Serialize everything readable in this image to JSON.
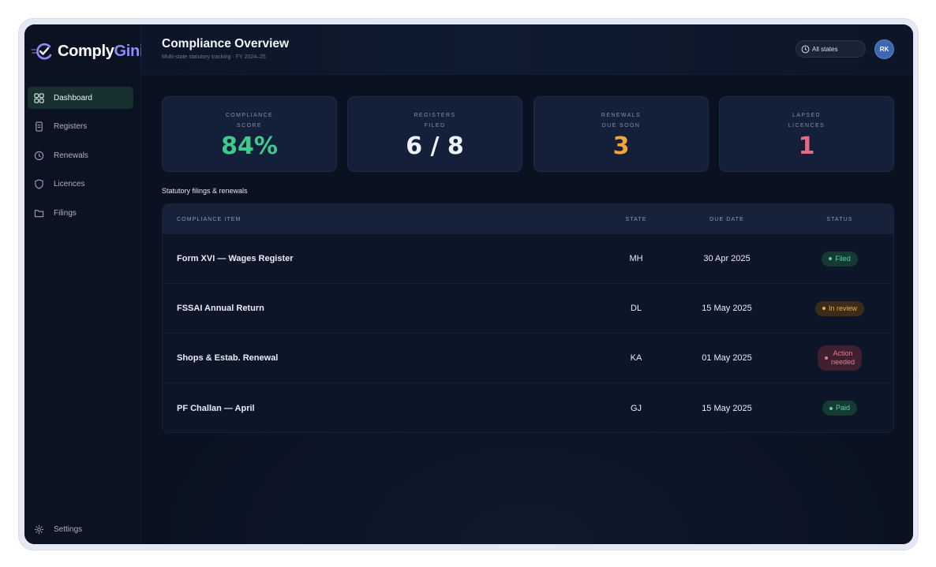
{
  "brand": {
    "name_main": "Comply",
    "name_accent": "Gini"
  },
  "sidebar": {
    "items": [
      {
        "label": "Dashboard",
        "icon": "grid-icon"
      },
      {
        "label": "Registers",
        "icon": "document-icon"
      },
      {
        "label": "Renewals",
        "icon": "clock-icon"
      },
      {
        "label": "Licences",
        "icon": "shield-icon"
      },
      {
        "label": "Filings",
        "icon": "folder-icon"
      }
    ],
    "settings_label": "Settings"
  },
  "header": {
    "title": "Compliance Overview",
    "subtitle": "Multi-state statutory tracking · FY 2024–25",
    "states_filter": "All states",
    "avatar_initials": "RK"
  },
  "kpis": [
    {
      "label": "COMPLIANCE\nSCORE",
      "value": "84%",
      "color": "#3fc98d"
    },
    {
      "label": "REGISTERS\nFILED",
      "value": "6 / 8",
      "color": "#eef2f8"
    },
    {
      "label": "RENEWALS\nDUE SOON",
      "value": "3",
      "color": "#f0a43d"
    },
    {
      "label": "LAPSED\nLICENCES",
      "value": "1",
      "color": "#e86a80"
    }
  ],
  "table": {
    "title": "Statutory filings & renewals",
    "columns": [
      "COMPLIANCE ITEM",
      "STATE",
      "DUE DATE",
      "STATUS"
    ],
    "rows": [
      {
        "item": "Form XVI — Wages Register",
        "state": "MH",
        "due": "30 Apr 2025",
        "status": "Filed",
        "tone": "green"
      },
      {
        "item": "FSSAI Annual Return",
        "state": "DL",
        "due": "15 May 2025",
        "status": "In review",
        "tone": "amber"
      },
      {
        "item": "Shops & Estab. Renewal",
        "state": "KA",
        "due": "01 May 2025",
        "status": "Action\nneeded",
        "tone": "red"
      },
      {
        "item": "PF Challan — April",
        "state": "GJ",
        "due": "15 May 2025",
        "status": "Paid",
        "tone": "green"
      }
    ]
  },
  "colors": {
    "background": "#0c1525",
    "accent": "#8f8bff",
    "active_nav": "#17302f"
  }
}
